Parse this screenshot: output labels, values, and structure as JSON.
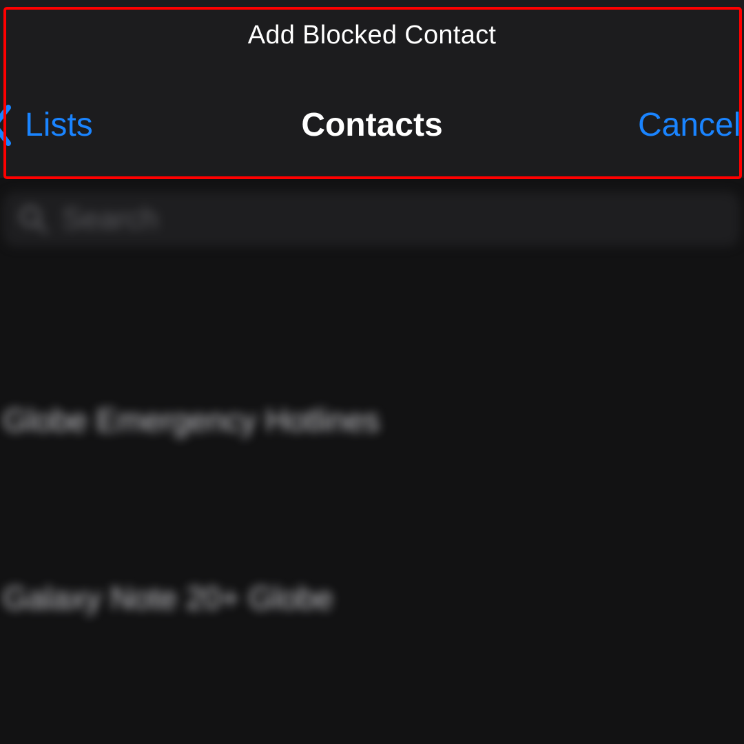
{
  "sheet": {
    "title": "Add Blocked Contact"
  },
  "nav": {
    "back_label": "Lists",
    "title": "Contacts",
    "cancel_label": "Cancel"
  },
  "search": {
    "placeholder": "Search",
    "icon": "search-icon"
  },
  "sections": [
    {
      "letter": "",
      "contacts": [
        "Globe Emergency Hotlines"
      ]
    },
    {
      "letter": "",
      "contacts": [
        "Galaxy Note 20+ Globe"
      ]
    },
    {
      "letter": ""
    }
  ],
  "colors": {
    "accent": "#1a84ff",
    "header_bg": "#1c1c1e",
    "background": "#121213",
    "highlight": "#ff0000"
  }
}
